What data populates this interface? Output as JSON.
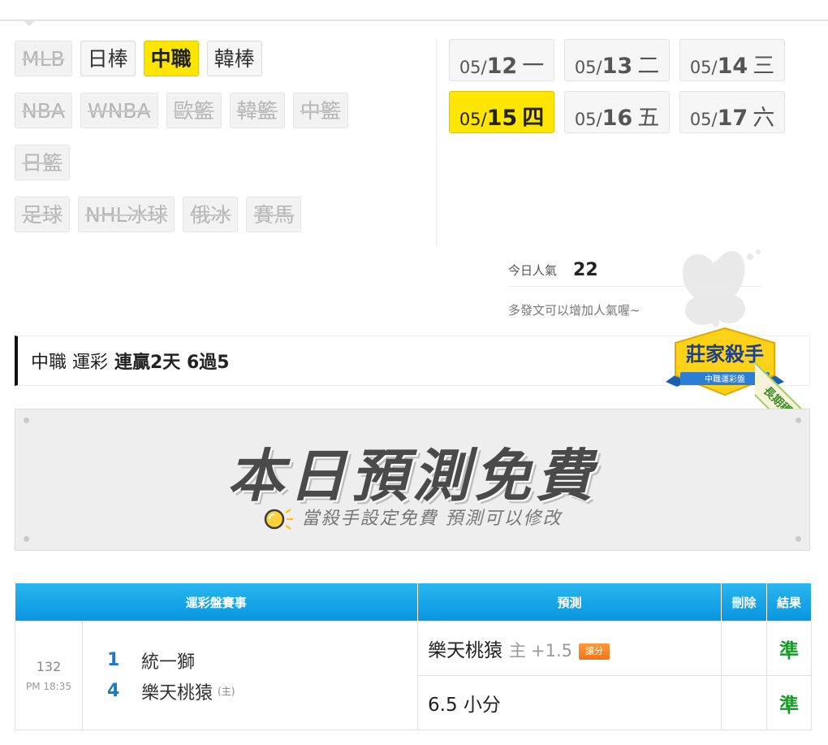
{
  "sports": [
    [
      {
        "label": "MLB",
        "state": "off"
      },
      {
        "label": "日棒",
        "state": "on"
      },
      {
        "label": "中職",
        "state": "active"
      },
      {
        "label": "韓棒",
        "state": "on"
      }
    ],
    [
      {
        "label": "NBA",
        "state": "off"
      },
      {
        "label": "WNBA",
        "state": "off"
      },
      {
        "label": "歐籃",
        "state": "off"
      },
      {
        "label": "韓籃",
        "state": "off"
      },
      {
        "label": "中籃",
        "state": "off"
      }
    ],
    [
      {
        "label": "日籃",
        "state": "off"
      }
    ],
    [
      {
        "label": "足球",
        "state": "off"
      },
      {
        "label": "NHL冰球",
        "state": "off"
      },
      {
        "label": "俄冰",
        "state": "off"
      },
      {
        "label": "賽馬",
        "state": "off"
      }
    ]
  ],
  "dates": [
    {
      "md": "05/",
      "day": "12",
      "wd": "一",
      "active": false
    },
    {
      "md": "05/",
      "day": "13",
      "wd": "二",
      "active": false
    },
    {
      "md": "05/",
      "day": "14",
      "wd": "三",
      "active": false
    },
    {
      "md": "05/",
      "day": "15",
      "wd": "四",
      "active": true
    },
    {
      "md": "05/",
      "day": "16",
      "wd": "五",
      "active": false
    },
    {
      "md": "05/",
      "day": "17",
      "wd": "六",
      "active": false
    }
  ],
  "popularity": {
    "label": "今日人氣",
    "count": "22",
    "hint": "多發文可以增加人氣喔~"
  },
  "record": {
    "prefix": "中職 運彩",
    "streak": "連贏2天 6過5"
  },
  "badge": {
    "title": "莊家殺手",
    "sub": "中職運彩盤",
    "ribbon": "長期穩定"
  },
  "banner": {
    "title": "本日預測免費",
    "subtitle": "當殺手設定免費  預測可以修改"
  },
  "table": {
    "headers": {
      "game": "運彩盤賽事",
      "prediction": "預測",
      "delete": "刪除",
      "result": "結果"
    },
    "row": {
      "game_no": "132",
      "time": "PM 18:35",
      "away_score": "1",
      "away_team": "統一獅",
      "home_score": "4",
      "home_team": "樂天桃猿",
      "home_mark": "(主)",
      "pred1_team": "樂天桃猿",
      "pred1_main": "主",
      "pred1_line": "+1.5",
      "pred1_tag": "讓分",
      "pred1_result": "準",
      "pred2": "6.5 小分",
      "pred2_result": "準"
    }
  },
  "colors": {
    "accent_yellow": "#ffe600",
    "table_header_blue": "#0a96e0",
    "result_green": "#1a9a2a",
    "score_blue": "#1a7cc1"
  }
}
